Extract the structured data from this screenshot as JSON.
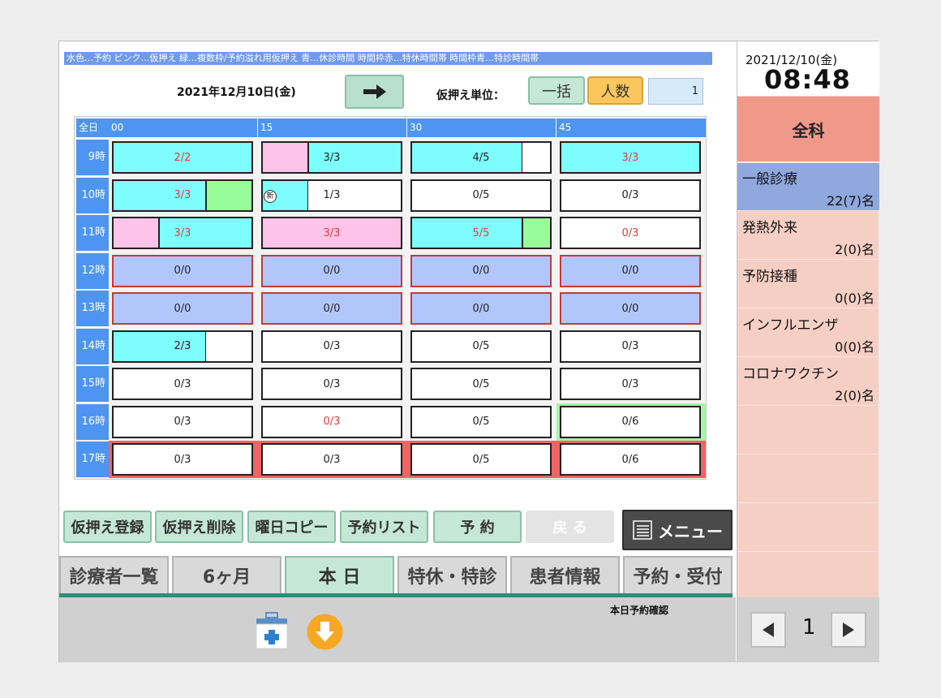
{
  "legend": "水色…予約 ピンク…仮押え 緑…複数枠/予約溢れ用仮押え 青…休診時間 時間枠赤…特休時間帯 時間枠青…特診時間帯",
  "header": {
    "date": "2021年12月10日(金)",
    "unit_label": "仮押え単位：",
    "btn_ikkatsu": "一括",
    "btn_ninzu": "人数",
    "unit_value": "1"
  },
  "grid": {
    "corner": "全日",
    "columns": [
      "00",
      "15",
      "30",
      "45"
    ],
    "rows": [
      {
        "hour": "9時",
        "cells": [
          "2/2",
          "3/3",
          "4/5",
          "3/3"
        ]
      },
      {
        "hour": "10時",
        "cells": [
          "3/3",
          "1/3",
          "0/5",
          "0/3"
        ]
      },
      {
        "hour": "11時",
        "cells": [
          "3/3",
          "3/3",
          "5/5",
          "0/3"
        ]
      },
      {
        "hour": "12時",
        "cells": [
          "0/0",
          "0/0",
          "0/0",
          "0/0"
        ]
      },
      {
        "hour": "13時",
        "cells": [
          "0/0",
          "0/0",
          "0/0",
          "0/0"
        ]
      },
      {
        "hour": "14時",
        "cells": [
          "2/3",
          "0/3",
          "0/5",
          "0/3"
        ]
      },
      {
        "hour": "15時",
        "cells": [
          "0/3",
          "0/3",
          "0/5",
          "0/3"
        ]
      },
      {
        "hour": "16時",
        "cells": [
          "0/3",
          "0/3",
          "0/5",
          "0/6"
        ]
      },
      {
        "hour": "17時",
        "cells": [
          "0/3",
          "0/3",
          "0/5",
          "0/6"
        ]
      }
    ],
    "new_mark": "新"
  },
  "buttons": {
    "register": "仮押え登録",
    "delete": "仮押え削除",
    "copy": "曜日コピー",
    "list": "予約リスト",
    "reserve": "予 約",
    "back": "戻 る",
    "menu": "メニュー"
  },
  "tabs": [
    "診療者一覧",
    "6ヶ月",
    "本 日",
    "特休・特診",
    "患者情報",
    "予約・受付"
  ],
  "footer": {
    "status": "本日予約確認"
  },
  "right": {
    "clock_date": "2021/12/10(金)",
    "clock_time": "08:48",
    "department": "全科",
    "clinics": [
      {
        "name": "一般診療",
        "count": "22(7)名"
      },
      {
        "name": "発熱外来",
        "count": "2(0)名"
      },
      {
        "name": "予防接種",
        "count": "0(0)名"
      },
      {
        "name": "インフルエンザ",
        "count": "0(0)名"
      },
      {
        "name": "コロナワクチン",
        "count": "2(0)名"
      }
    ],
    "page": "1"
  },
  "colors": {
    "reserved": "#7dfdfd",
    "provisional": "#fdc3e8",
    "multi": "#98fd98",
    "closed": "#b3c6fc",
    "special_holiday": "#f06464",
    "special_clinic": "#a4f6a4"
  }
}
